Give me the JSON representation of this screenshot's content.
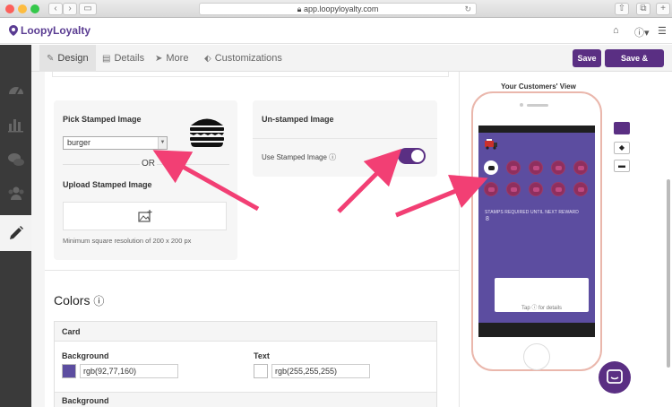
{
  "browser": {
    "url": "app.loopyloyalty.com"
  },
  "app": {
    "brand": "LoopyLoyalty"
  },
  "tabs": [
    {
      "label": "Design",
      "icon": "pencil-icon"
    },
    {
      "label": "Details",
      "icon": "file-icon"
    },
    {
      "label": "More",
      "icon": "send-icon"
    },
    {
      "label": "Customizations",
      "icon": "tags-icon"
    }
  ],
  "actions": {
    "save": "Save",
    "save_preview": "Save & Preview"
  },
  "stamped": {
    "title": "Pick Stamped Image",
    "selected": "burger",
    "or": "OR",
    "upload_title": "Upload Stamped Image",
    "hint": "Minimum square resolution of 200 x 200 px"
  },
  "unstamped": {
    "title": "Un-stamped Image",
    "use_label": "Use Stamped Image",
    "toggle_on": true
  },
  "colors": {
    "title": "Colors",
    "section": "Card",
    "background_label": "Background",
    "background_value": "rgb(92,77,160)",
    "text_label": "Text",
    "text_value": "rgb(255,255,255)",
    "next_section": "Background"
  },
  "preview": {
    "title": "Your Customers' View",
    "stamps_label": "STAMPS REQUIRED UNTIL NEXT REWARD",
    "stamps_count": "8",
    "tap_text": "Tap ⓘ for details"
  },
  "theme": {
    "accent": "#5a2f83",
    "card": "#5c4da0",
    "stamp": "#8f2f5e",
    "arrow": "#f23f74"
  }
}
